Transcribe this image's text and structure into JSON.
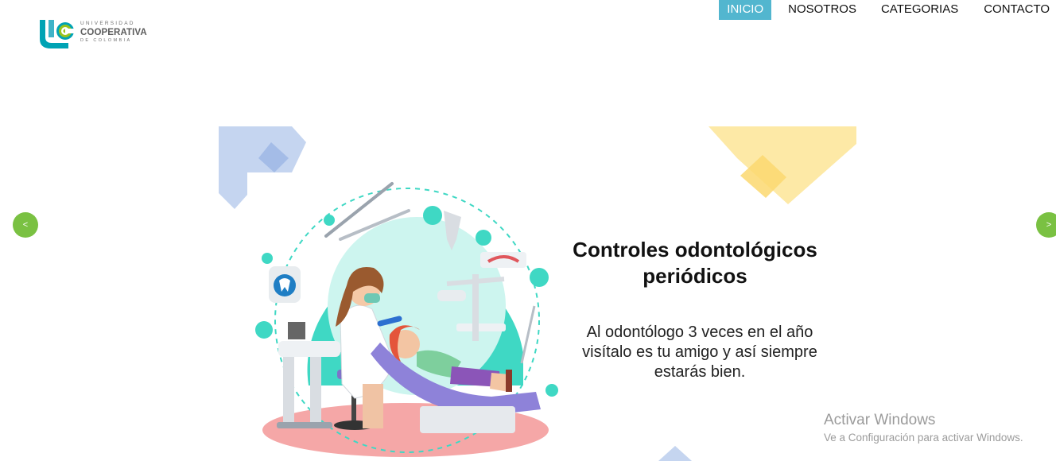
{
  "header": {
    "logo": {
      "line1": "UNIVERSIDAD",
      "line2": "COOPERATIVA",
      "line3": "DE COLOMBIA"
    },
    "nav": [
      {
        "label": "INICIO",
        "active": true
      },
      {
        "label": "NOSOTROS",
        "active": false
      },
      {
        "label": "CATEGORIAS",
        "active": false
      },
      {
        "label": "CONTACTO",
        "active": false
      }
    ]
  },
  "carousel": {
    "prev_label": "<",
    "next_label": ">",
    "slide": {
      "title": "Controles odontológicos periódicos",
      "text": "Al odontólogo 3 veces en el año visítalo es tu amigo y así siempre estarás bien.",
      "illustration": "dentist-treating-child-illustration"
    }
  },
  "watermark": {
    "title": "Activar Windows",
    "subtitle": "Ve a Configuración para activar Windows."
  },
  "colors": {
    "nav_active_bg": "#52b6cf",
    "carousel_button": "#7ac142",
    "shape_blue": "#c5d5f0",
    "shape_yellow": "#fde9a6",
    "brand_teal": "#00a3b4",
    "brand_green": "#9ac31c"
  }
}
